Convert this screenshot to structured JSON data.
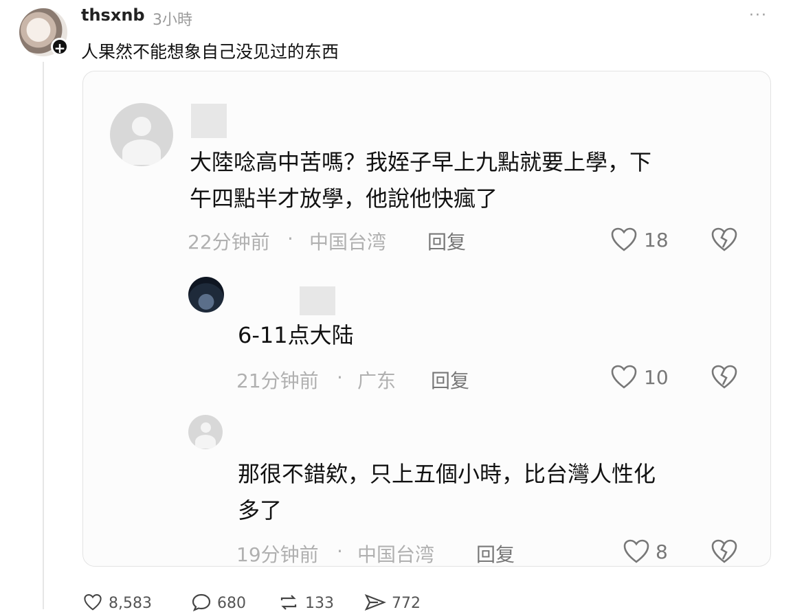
{
  "post": {
    "username": "thsxnb",
    "time": "3小時",
    "text": "人果然不能想象自己没见过的东西",
    "follow_symbol": "+",
    "more_symbol": "···"
  },
  "comments": [
    {
      "text_line1": "大陸唸高中苦嗎？我姪子早上九點就要上學，下",
      "text_line2": "午四點半才放學，他說他快瘋了",
      "time": "22分钟前",
      "sep": "·",
      "location": "中国台湾",
      "reply_label": "回复",
      "likes": "18"
    },
    {
      "text_line1": "6-11点大陆",
      "time": "21分钟前",
      "sep": "·",
      "location": "广东",
      "reply_label": "回复",
      "likes": "10"
    },
    {
      "text_line1": "那很不錯欸，只上五個小時，比台灣人性化",
      "text_line2": "多了",
      "time": "19分钟前",
      "sep": "·",
      "location": "中国台湾",
      "reply_label": "回复",
      "likes": "8"
    }
  ],
  "footer": {
    "likes": "8,583",
    "comments": "680",
    "reposts": "133",
    "shares": "772"
  },
  "icons": {
    "heart": "heart-icon",
    "broken_heart": "dislike-heart-icon",
    "comment": "comment-icon",
    "repost": "repost-icon",
    "share": "share-icon",
    "more": "more-icon"
  }
}
